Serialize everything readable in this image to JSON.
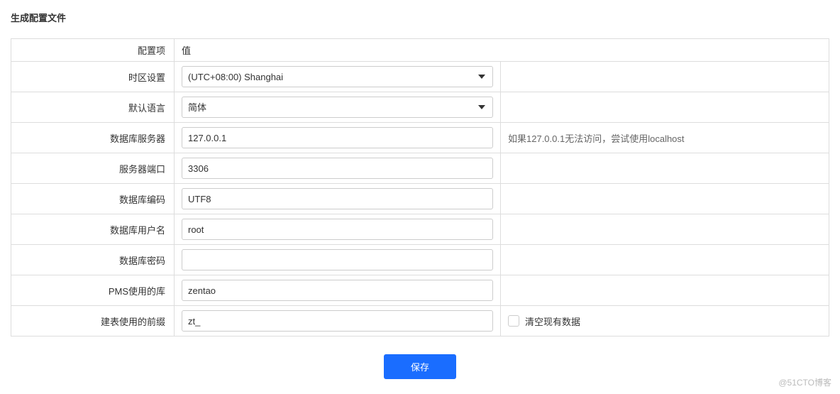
{
  "page": {
    "title": "生成配置文件"
  },
  "header": {
    "label": "配置项",
    "value": "值"
  },
  "rows": {
    "timezone": {
      "label": "时区设置",
      "value": "(UTC+08:00) Shanghai"
    },
    "language": {
      "label": "默认语言",
      "value": "简体"
    },
    "dbhost": {
      "label": "数据库服务器",
      "value": "127.0.0.1",
      "hint": "如果127.0.0.1无法访问，尝试使用localhost"
    },
    "dbport": {
      "label": "服务器端口",
      "value": "3306"
    },
    "dbencoding": {
      "label": "数据库编码",
      "value": "UTF8"
    },
    "dbuser": {
      "label": "数据库用户名",
      "value": "root"
    },
    "dbpass": {
      "label": "数据库密码",
      "value": ""
    },
    "dbname": {
      "label": "PMS使用的库",
      "value": "zentao"
    },
    "tableprefix": {
      "label": "建表使用的前缀",
      "value": "zt_",
      "checkbox_label": "清空现有数据"
    }
  },
  "buttons": {
    "save": "保存"
  },
  "watermark": "@51CTO博客"
}
